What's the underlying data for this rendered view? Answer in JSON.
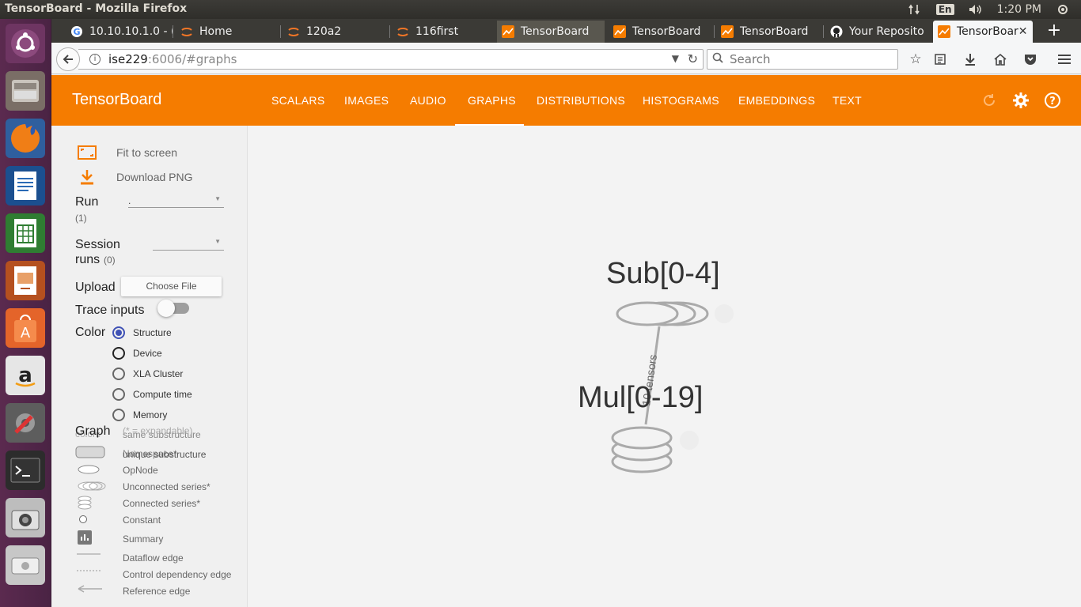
{
  "os": {
    "window_title": "TensorBoard - Mozilla Firefox",
    "lang": "En",
    "time": "1:20 PM"
  },
  "tabs": [
    {
      "label": "10.10.10.1.0 - (",
      "icon": "google-icon"
    },
    {
      "label": "Home",
      "icon": "jupyter-icon"
    },
    {
      "label": "120a2",
      "icon": "jupyter-icon"
    },
    {
      "label": "116first",
      "icon": "jupyter-icon"
    },
    {
      "label": "TensorBoard",
      "icon": "tensorboard-icon"
    },
    {
      "label": "TensorBoard",
      "icon": "tensorboard-icon"
    },
    {
      "label": "TensorBoard",
      "icon": "tensorboard-icon"
    },
    {
      "label": "Your Reposito",
      "icon": "github-icon"
    },
    {
      "label": "TensorBoar",
      "icon": "tensorboard-icon",
      "active": true
    }
  ],
  "nav": {
    "url_host": "ise229",
    "url_rest": ":6006/#graphs",
    "search_placeholder": "Search"
  },
  "tb": {
    "title": "TensorBoard",
    "tabs": [
      "SCALARS",
      "IMAGES",
      "AUDIO",
      "GRAPHS",
      "DISTRIBUTIONS",
      "HISTOGRAMS",
      "EMBEDDINGS",
      "TEXT"
    ],
    "active_tab": "GRAPHS",
    "accent": "#f57c00"
  },
  "sidebar": {
    "fit_label": "Fit to screen",
    "download_label": "Download PNG",
    "run_label": "Run",
    "run_count": "(1)",
    "run_value": ".",
    "session_label_1": "Session",
    "session_label_2": "runs",
    "session_count": "(0)",
    "upload_label": "Upload",
    "choose_file": "Choose File",
    "trace_label": "Trace inputs",
    "color_label": "Color",
    "color_options": [
      "Structure",
      "Device",
      "XLA Cluster",
      "Compute time",
      "Memory"
    ],
    "color_selected": "Structure",
    "legend_overlap_1": "colors",
    "legend_overlap_2": "same substructure",
    "legend_overlap_3": "(* = expandable)",
    "graph_label": "Graph",
    "legend": {
      "namespace": "Namespace*",
      "unique": "unique substructure",
      "opnode": "OpNode",
      "unconnected": "Unconnected series*",
      "connected": "Connected series*",
      "constant": "Constant",
      "summary": "Summary",
      "dataflow": "Dataflow edge",
      "control": "Control dependency edge",
      "reference": "Reference edge"
    }
  },
  "graph": {
    "node_top": "Sub[0-4]",
    "node_bottom": "Mul[0-19]",
    "edge_label": "10 tensors"
  }
}
